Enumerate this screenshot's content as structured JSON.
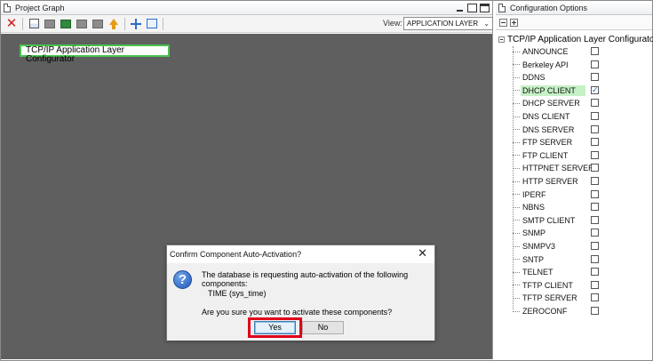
{
  "project_graph": {
    "title": "Project Graph",
    "view_label": "View:",
    "view_value": "APPLICATION LAYER",
    "node_label": "TCP/IP Application Layer Configurator"
  },
  "toolbar_icons": [
    "delete-icon",
    "new-icon",
    "gray-box-icon",
    "export-icon",
    "gray-box-icon",
    "gray-box-icon",
    "upload-arrow-icon",
    "crosshair-icon",
    "frame-icon"
  ],
  "dialog": {
    "title": "Confirm Component Auto-Activation?",
    "close": "✕",
    "message": "The database is requesting auto-activation of the following components:",
    "component": "TIME (sys_time)",
    "question": "Are you sure you want to activate these components?",
    "yes_label": "Yes",
    "no_label": "No",
    "icon": "?"
  },
  "config": {
    "title": "Configuration Options",
    "root": "TCP/IP Application Layer Configurator",
    "items": [
      {
        "label": "ANNOUNCE",
        "checked": false
      },
      {
        "label": "Berkeley API",
        "checked": false
      },
      {
        "label": "DDNS",
        "checked": false
      },
      {
        "label": "DHCP CLIENT",
        "checked": true,
        "selected": true
      },
      {
        "label": "DHCP SERVER",
        "checked": false
      },
      {
        "label": "DNS CLIENT",
        "checked": false
      },
      {
        "label": "DNS SERVER",
        "checked": false
      },
      {
        "label": "FTP SERVER",
        "checked": false
      },
      {
        "label": "FTP CLIENT",
        "checked": false
      },
      {
        "label": "HTTPNET SERVER",
        "checked": false
      },
      {
        "label": "HTTP SERVER",
        "checked": false
      },
      {
        "label": "IPERF",
        "checked": false
      },
      {
        "label": "NBNS",
        "checked": false
      },
      {
        "label": "SMTP CLIENT",
        "checked": false
      },
      {
        "label": "SNMP",
        "checked": false
      },
      {
        "label": "SNMPV3",
        "checked": false
      },
      {
        "label": "SNTP",
        "checked": false
      },
      {
        "label": "TELNET",
        "checked": false
      },
      {
        "label": "TFTP CLIENT",
        "checked": false
      },
      {
        "label": "TFTP SERVER",
        "checked": false
      },
      {
        "label": "ZEROCONF",
        "checked": false
      }
    ]
  },
  "colors": {
    "canvas": "#5f5f5f",
    "node_border": "#49c24f",
    "highlight": "#e0001a",
    "selected_item": "#c6f1c6"
  }
}
